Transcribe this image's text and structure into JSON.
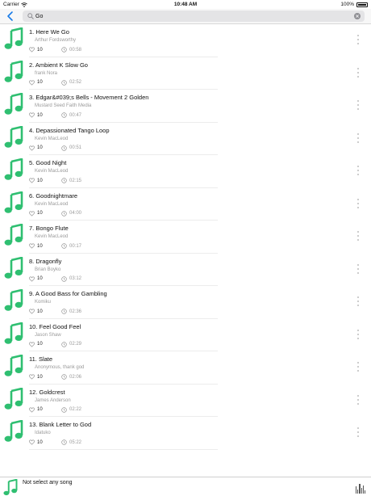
{
  "status_bar": {
    "carrier": "Carrier",
    "time": "10:48 AM",
    "battery": "100%"
  },
  "search": {
    "value": "Go",
    "back_icon": "chevron-left-icon",
    "search_icon": "magnifier-icon",
    "clear_icon": "clear-x-icon"
  },
  "colors": {
    "accent": "#1a7ce8",
    "note_green": "#2fbf71",
    "row_divider": "#ececec"
  },
  "songs": [
    {
      "title": "1. Here We Go",
      "artist": "Arthur Fordsworthy",
      "likes": "10",
      "duration": "00:58"
    },
    {
      "title": "2. Ambient K Slow Go",
      "artist": "frank Nora",
      "likes": "10",
      "duration": "02:52"
    },
    {
      "title": "3. Edgar&#039;s Bells - Movement 2 Golden",
      "artist": "Mustard Seed Faith Media",
      "likes": "10",
      "duration": "00:47"
    },
    {
      "title": "4. Depassionated Tango Loop",
      "artist": "Kevin MacLeod",
      "likes": "10",
      "duration": "00:51"
    },
    {
      "title": "5. Good Night",
      "artist": "Kevin MacLeod",
      "likes": "10",
      "duration": "02:15"
    },
    {
      "title": "6. Goodnightmare",
      "artist": "Kevin MacLeod",
      "likes": "10",
      "duration": "04:00"
    },
    {
      "title": "7. Bongo Flute",
      "artist": "Kevin MacLeod",
      "likes": "10",
      "duration": "00:17"
    },
    {
      "title": "8. Dragonfly",
      "artist": "Brian Boyko",
      "likes": "10",
      "duration": "03:12"
    },
    {
      "title": "9. A Good Bass for Gambling",
      "artist": "Komiku",
      "likes": "10",
      "duration": "02:36"
    },
    {
      "title": "10. Feel Good Feel",
      "artist": "Jason Shaw",
      "likes": "10",
      "duration": "02:29"
    },
    {
      "title": "11. Slate",
      "artist": "Anonymous, thank god",
      "likes": "10",
      "duration": "02:06"
    },
    {
      "title": "12. Goldcrest",
      "artist": "James Anderson",
      "likes": "10",
      "duration": "02:22"
    },
    {
      "title": "13. Blank Letter to God",
      "artist": "Idatuko",
      "likes": "10",
      "duration": "05:22"
    }
  ],
  "player": {
    "now_playing": "Not select any song",
    "eq_icon": "equalizer-bars-icon"
  }
}
